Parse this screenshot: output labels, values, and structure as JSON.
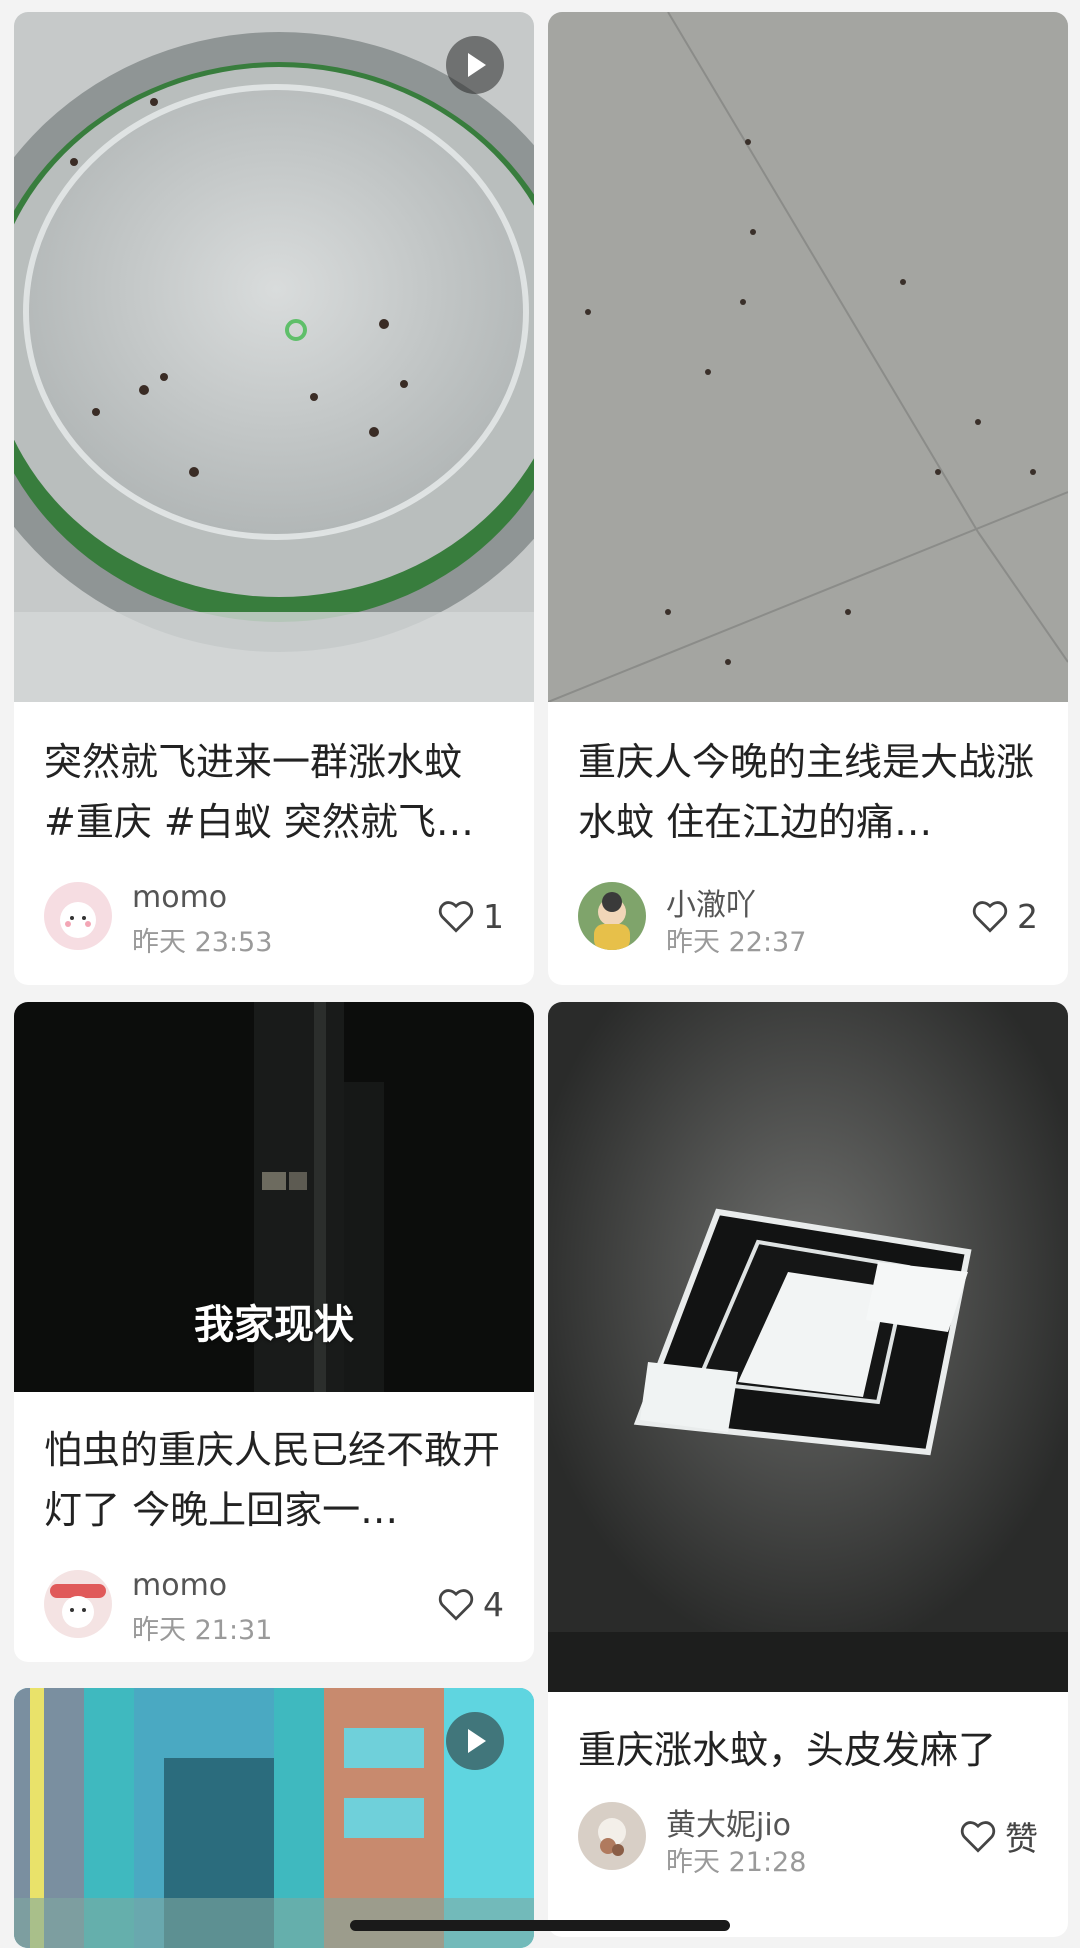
{
  "feed": [
    {
      "title": "突然就飞进来一群涨水蚊 #重庆 #白蚁 突然就飞…",
      "author": "momo",
      "time": "昨天 23:53",
      "likes": "1",
      "is_video": true
    },
    {
      "title": "重庆人今晚的主线是大战涨水蚊 住在江边的痛…",
      "author": "小澈吖",
      "time": "昨天 22:37",
      "likes": "2",
      "is_video": false
    },
    {
      "title": "怕虫的重庆人民已经不敢开灯了 今晚上回家一…",
      "overlay_text": "我家现状",
      "author": "momo",
      "time": "昨天 21:31",
      "likes": "4",
      "is_video": false
    },
    {
      "title": "重庆涨水蚊，头皮发麻了",
      "author": "黄大妮jio",
      "time": "昨天 21:28",
      "likes": "赞",
      "is_video": false
    },
    {
      "is_video": true
    }
  ],
  "icons": {
    "like": "heart-outline-icon",
    "play": "play-icon"
  },
  "colors": {
    "page_bg": "#f3f3f3",
    "card_bg": "#ffffff",
    "title_text": "#222222",
    "meta_text": "#9a9a9a"
  }
}
